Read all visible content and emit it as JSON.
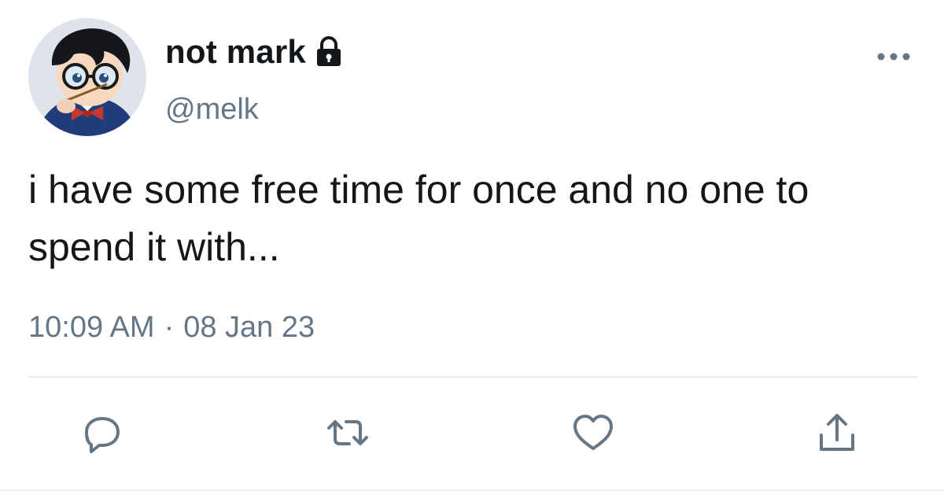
{
  "user": {
    "display_name": "not mark",
    "handle": "@melk",
    "locked": true,
    "avatar_alt": "avatar"
  },
  "tweet": {
    "text": "i have some free time for once and no one to spend it with...",
    "time": "10:09 AM",
    "separator": "·",
    "date": "08 Jan 23"
  },
  "actions": {
    "reply_icon": "reply-icon",
    "retweet_icon": "retweet-icon",
    "like_icon": "heart-icon",
    "share_icon": "share-icon"
  },
  "colors": {
    "text_primary": "#14171a",
    "text_secondary": "#657786",
    "icon_gray": "#657786",
    "divider": "#e6ecf0"
  }
}
